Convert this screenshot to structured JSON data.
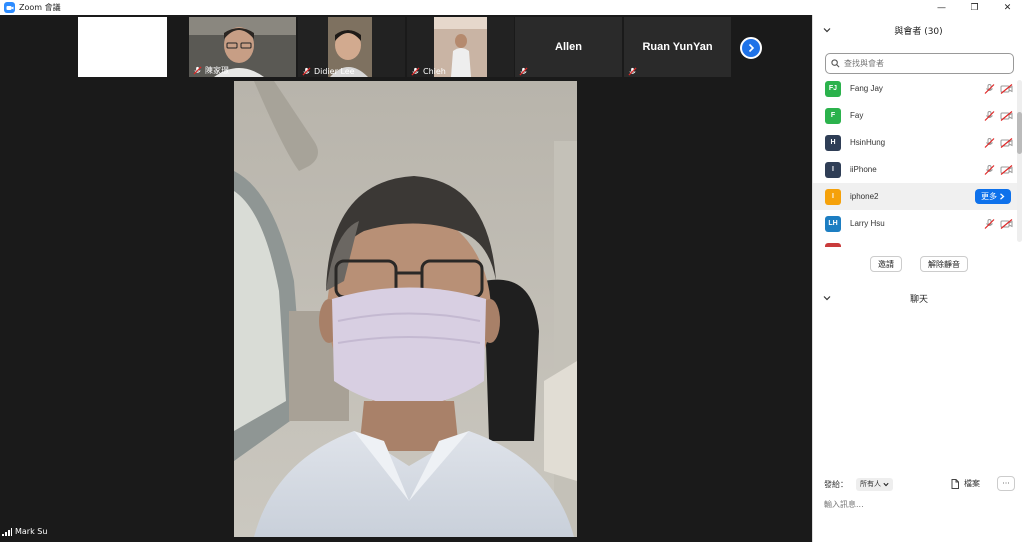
{
  "window": {
    "title": "Zoom 會議",
    "controls": [
      "—",
      "❐",
      "✕"
    ]
  },
  "thumbnails": [
    {
      "name": "",
      "type": "blank"
    },
    {
      "name": "陳家璟",
      "type": "video",
      "muted": true
    },
    {
      "name": "Didier Lee",
      "type": "video",
      "muted": true
    },
    {
      "name": "Chieh",
      "type": "video",
      "muted": true
    },
    {
      "name": "Allen",
      "type": "name",
      "muted": true
    },
    {
      "name": "Ruan YunYan",
      "type": "name",
      "muted": true
    }
  ],
  "main_video": {
    "self_name": "Mark Su"
  },
  "participants_panel": {
    "title": "與會者 (30)",
    "search_placeholder": "查找與會者",
    "participants": [
      {
        "initials": "FJ",
        "name": "Fang Jay",
        "color": "#2bb24c"
      },
      {
        "initials": "F",
        "name": "Fay",
        "color": "#2bb24c"
      },
      {
        "initials": "H",
        "name": "HsinHung",
        "color": "#2f3e56"
      },
      {
        "initials": "I",
        "name": "iiPhone",
        "color": "#2f3e56"
      },
      {
        "initials": "I",
        "name": "iphone2",
        "color": "#f5a10a",
        "hover": true
      },
      {
        "initials": "LH",
        "name": "Larry Hsu",
        "color": "#1d7ec2"
      }
    ],
    "more_label": "更多",
    "invite_label": "邀請",
    "unmute_label": "解除靜音"
  },
  "chat": {
    "title": "聊天",
    "send_to_label": "發給：",
    "send_to_value": "所有人",
    "file_label": "檔案",
    "more_label": "···",
    "input_placeholder": "輸入訊息..."
  },
  "colors": {
    "accent": "#0e71eb",
    "muted_red": "#e02828"
  }
}
